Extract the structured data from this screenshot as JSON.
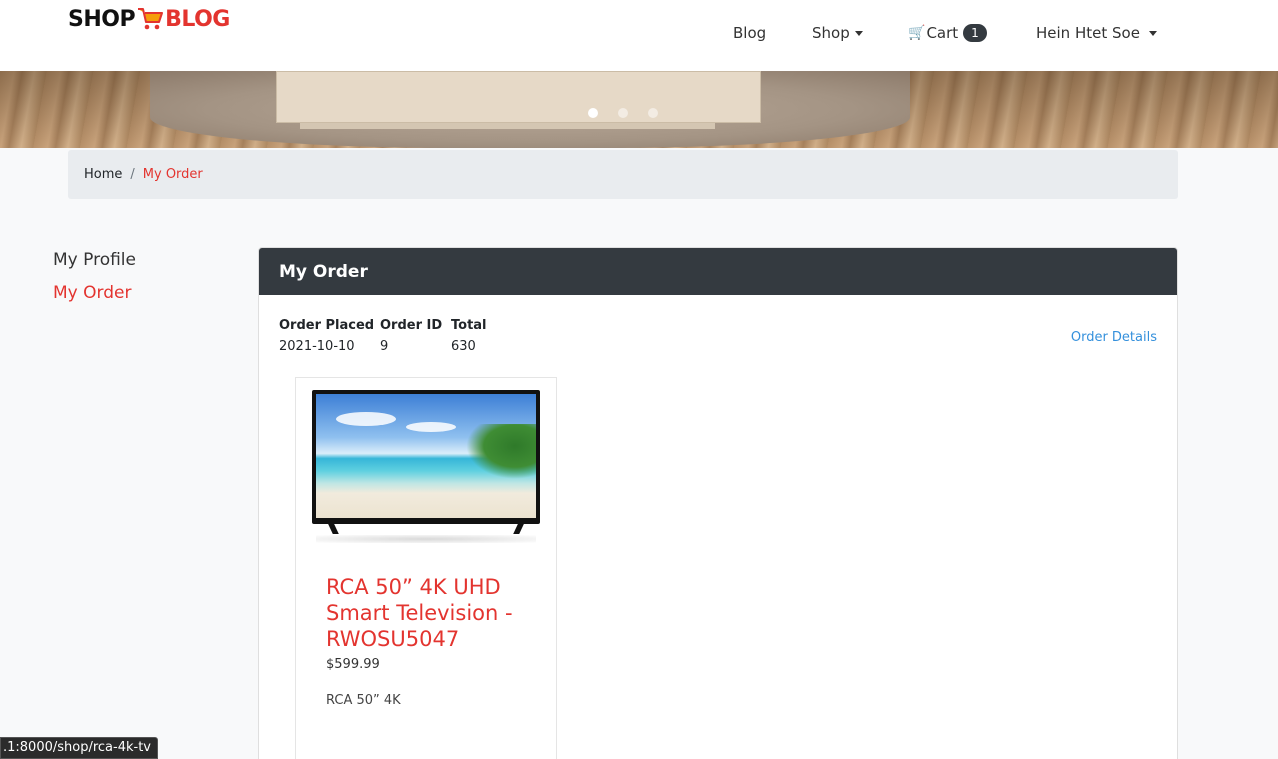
{
  "brand": {
    "part1": "SHOP",
    "part2": "BLOG",
    "logo_icon": "shopping-cart-icon"
  },
  "nav": {
    "blog": "Blog",
    "shop": "Shop",
    "cart": "Cart",
    "cart_count": "1",
    "user": "Hein Htet Soe"
  },
  "carousel": {
    "slides": 3,
    "active": 1
  },
  "breadcrumb": {
    "home": "Home",
    "separator": "/",
    "current": "My Order"
  },
  "sidebar": {
    "items": [
      {
        "label": "My Profile"
      },
      {
        "label": "My Order"
      }
    ]
  },
  "order_card": {
    "title": "My Order",
    "order_placed_label": "Order Placed",
    "order_placed_value": "2021-10-10",
    "order_id_label": "Order ID",
    "order_id_value": "9",
    "total_label": "Total",
    "total_value": "630",
    "details_link": "Order Details"
  },
  "product": {
    "name": "RCA 50” 4K UHD Smart Television - RWOSU5047",
    "price": "$599.99",
    "description": "RCA 50” 4K"
  },
  "status_bar": {
    "url": ".1:8000/shop/rca-4k-tv"
  },
  "colors": {
    "accent": "#e3342f",
    "header_dark": "#343a40",
    "link_blue": "#3490dc"
  }
}
